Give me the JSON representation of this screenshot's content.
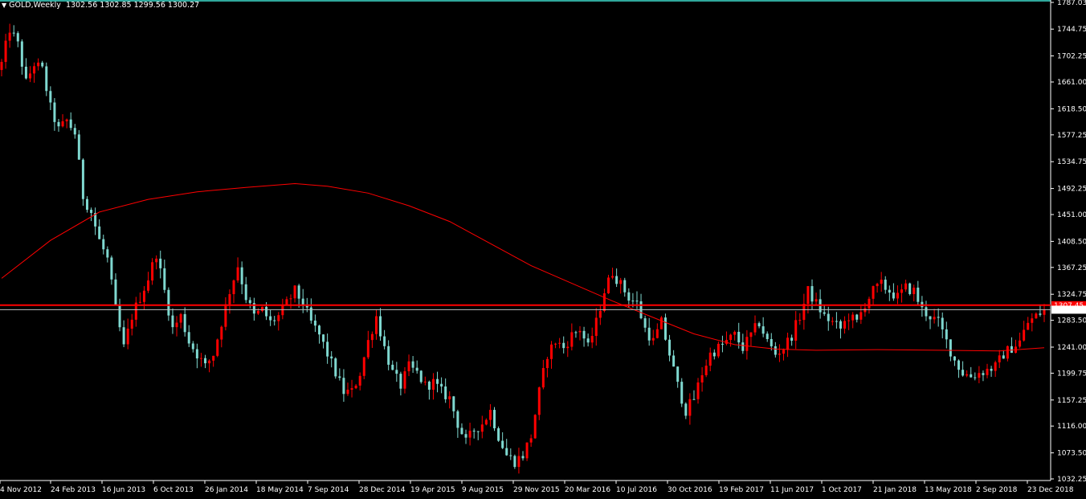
{
  "header": {
    "symbol": "GOLD,Weekly",
    "ohlc": "1302.56 1302.85 1299.56 1300.27",
    "menu_icon": "triangle-down-icon"
  },
  "colors": {
    "background": "#000000",
    "bull": "#ff0000",
    "bear": "#7fd8d0",
    "ma": "#ff0000",
    "hline": "#ff0000",
    "bidline": "#c0c0c0",
    "axis": "#ffffff",
    "top_border": "#40e0d0"
  },
  "chart_data": {
    "type": "candlestick",
    "symbol": "GOLD",
    "timeframe": "Weekly",
    "last_ohlc": {
      "open": 1302.56,
      "high": 1302.85,
      "low": 1299.56,
      "close": 1300.27
    },
    "y_ticks": [
      1787.03,
      1744.75,
      1702.25,
      1661.0,
      1618.5,
      1577.25,
      1534.75,
      1492.25,
      1451.0,
      1408.5,
      1367.25,
      1324.75,
      1283.5,
      1241.0,
      1199.75,
      1157.25,
      1116.0,
      1073.5,
      1032.25
    ],
    "y_tick_labels": [
      "1787.03",
      "1744.75",
      "1702.25",
      "1661.00",
      "1618.50",
      "1577.25",
      "1534.75",
      "1492.25",
      "1451.00",
      "1408.50",
      "1367.25",
      "1324.75",
      "1283.50",
      "1241.00",
      "1199.75",
      "1157.25",
      "1116.00",
      "1073.50",
      "1032.25"
    ],
    "ylim": [
      1025.0,
      1790.0
    ],
    "x_labels": [
      "4 Nov 2012",
      "24 Feb 2013",
      "16 Jun 2013",
      "6 Oct 2013",
      "26 Jan 2014",
      "18 May 2014",
      "7 Sep 2014",
      "28 Dec 2014",
      "19 Apr 2015",
      "9 Aug 2015",
      "29 Nov 2015",
      "20 Mar 2016",
      "10 Jul 2016",
      "30 Oct 2016",
      "19 Feb 2017",
      "11 Jun 2017",
      "1 Oct 2017",
      "21 Jan 2018",
      "13 May 2018",
      "2 Sep 2018",
      "23 Dec 2018"
    ],
    "horizontal_line": {
      "price": 1307.45,
      "label": "1307.45"
    },
    "bid_line": {
      "price": 1300.27,
      "label": "1300.27"
    },
    "close_path": [
      [
        0,
        1690
      ],
      [
        2,
        1745
      ],
      [
        4,
        1720
      ],
      [
        6,
        1660
      ],
      [
        8,
        1690
      ],
      [
        10,
        1680
      ],
      [
        12,
        1620
      ],
      [
        14,
        1585
      ],
      [
        16,
        1600
      ],
      [
        18,
        1580
      ],
      [
        20,
        1480
      ],
      [
        22,
        1455
      ],
      [
        24,
        1410
      ],
      [
        26,
        1380
      ],
      [
        28,
        1300
      ],
      [
        30,
        1240
      ],
      [
        32,
        1290
      ],
      [
        34,
        1320
      ],
      [
        36,
        1350
      ],
      [
        38,
        1390
      ],
      [
        40,
        1330
      ],
      [
        42,
        1270
      ],
      [
        44,
        1290
      ],
      [
        46,
        1250
      ],
      [
        48,
        1230
      ],
      [
        50,
        1210
      ],
      [
        52,
        1230
      ],
      [
        54,
        1280
      ],
      [
        56,
        1330
      ],
      [
        58,
        1370
      ],
      [
        60,
        1320
      ],
      [
        62,
        1290
      ],
      [
        64,
        1300
      ],
      [
        66,
        1280
      ],
      [
        68,
        1290
      ],
      [
        70,
        1310
      ],
      [
        72,
        1330
      ],
      [
        74,
        1310
      ],
      [
        76,
        1280
      ],
      [
        78,
        1260
      ],
      [
        80,
        1230
      ],
      [
        82,
        1200
      ],
      [
        84,
        1170
      ],
      [
        86,
        1170
      ],
      [
        88,
        1200
      ],
      [
        90,
        1250
      ],
      [
        92,
        1290
      ],
      [
        94,
        1240
      ],
      [
        96,
        1200
      ],
      [
        98,
        1180
      ],
      [
        100,
        1210
      ],
      [
        102,
        1200
      ],
      [
        104,
        1180
      ],
      [
        106,
        1185
      ],
      [
        108,
        1170
      ],
      [
        110,
        1160
      ],
      [
        112,
        1120
      ],
      [
        114,
        1090
      ],
      [
        116,
        1110
      ],
      [
        118,
        1120
      ],
      [
        120,
        1140
      ],
      [
        122,
        1100
      ],
      [
        124,
        1070
      ],
      [
        126,
        1060
      ],
      [
        128,
        1070
      ],
      [
        130,
        1100
      ],
      [
        132,
        1170
      ],
      [
        134,
        1230
      ],
      [
        136,
        1250
      ],
      [
        138,
        1240
      ],
      [
        140,
        1260
      ],
      [
        142,
        1270
      ],
      [
        144,
        1240
      ],
      [
        146,
        1280
      ],
      [
        148,
        1330
      ],
      [
        150,
        1360
      ],
      [
        152,
        1340
      ],
      [
        154,
        1320
      ],
      [
        156,
        1310
      ],
      [
        158,
        1270
      ],
      [
        160,
        1250
      ],
      [
        162,
        1280
      ],
      [
        164,
        1230
      ],
      [
        166,
        1180
      ],
      [
        168,
        1140
      ],
      [
        170,
        1160
      ],
      [
        172,
        1200
      ],
      [
        174,
        1230
      ],
      [
        176,
        1240
      ],
      [
        178,
        1250
      ],
      [
        180,
        1260
      ],
      [
        182,
        1240
      ],
      [
        184,
        1260
      ],
      [
        186,
        1280
      ],
      [
        188,
        1250
      ],
      [
        190,
        1230
      ],
      [
        192,
        1240
      ],
      [
        194,
        1260
      ],
      [
        196,
        1290
      ],
      [
        198,
        1330
      ],
      [
        200,
        1310
      ],
      [
        202,
        1290
      ],
      [
        204,
        1280
      ],
      [
        206,
        1270
      ],
      [
        208,
        1290
      ],
      [
        210,
        1280
      ],
      [
        212,
        1310
      ],
      [
        214,
        1330
      ],
      [
        216,
        1340
      ],
      [
        218,
        1330
      ],
      [
        220,
        1320
      ],
      [
        222,
        1335
      ],
      [
        224,
        1330
      ],
      [
        226,
        1300
      ],
      [
        228,
        1290
      ],
      [
        230,
        1280
      ],
      [
        232,
        1250
      ],
      [
        234,
        1220
      ],
      [
        236,
        1200
      ],
      [
        238,
        1195
      ],
      [
        240,
        1200
      ],
      [
        242,
        1205
      ],
      [
        244,
        1210
      ],
      [
        246,
        1230
      ],
      [
        248,
        1240
      ],
      [
        250,
        1250
      ],
      [
        252,
        1280
      ],
      [
        254,
        1290
      ],
      [
        256,
        1300
      ]
    ],
    "moving_average": [
      [
        0,
        1350
      ],
      [
        12,
        1410
      ],
      [
        24,
        1455
      ],
      [
        36,
        1475
      ],
      [
        48,
        1487
      ],
      [
        60,
        1494
      ],
      [
        72,
        1500
      ],
      [
        80,
        1496
      ],
      [
        90,
        1485
      ],
      [
        100,
        1465
      ],
      [
        110,
        1440
      ],
      [
        120,
        1405
      ],
      [
        130,
        1370
      ],
      [
        140,
        1342
      ],
      [
        150,
        1314
      ],
      [
        160,
        1288
      ],
      [
        170,
        1262
      ],
      [
        180,
        1245
      ],
      [
        190,
        1238
      ],
      [
        200,
        1236
      ],
      [
        215,
        1237
      ],
      [
        230,
        1236
      ],
      [
        245,
        1235
      ],
      [
        256,
        1240
      ]
    ]
  }
}
